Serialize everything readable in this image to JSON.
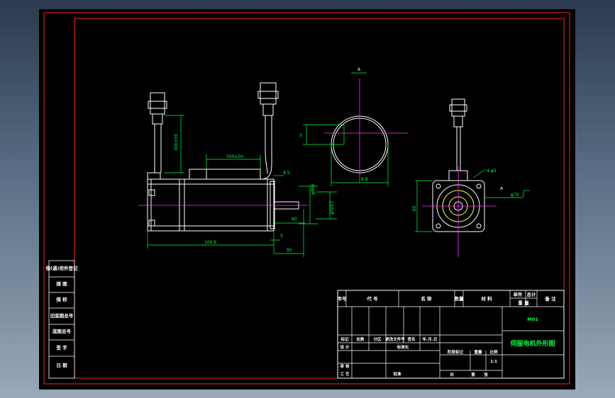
{
  "drawing": {
    "title": "伺服电机外形图",
    "part_code": "M01",
    "scale": "1:1",
    "sheet_total": "共",
    "sheet_page": "第",
    "sheet_unit": "张"
  },
  "dimensions": {
    "cable1_length": "300±50",
    "cable2_length": "300±50",
    "flange_thickness": "8.5",
    "shaft_dia": "φ8h6",
    "pilot_dia": "φ50h7",
    "shaft_length": "60",
    "body_length": "100.6",
    "lip": "5",
    "overall": "95",
    "key_depth": "3",
    "keyway_width": "8.8",
    "flange_square": "60",
    "hole_callout": "4-φ5",
    "hole_pcd": "φ70",
    "section_mark": "A"
  },
  "side_table": [
    {
      "label": "借(通)用件登记"
    },
    {
      "label": "描 图"
    },
    {
      "label": "描 校"
    },
    {
      "label": "旧底图总号"
    },
    {
      "label": "底图总号"
    },
    {
      "label": "签 字"
    },
    {
      "label": "日 期"
    }
  ],
  "title_block": {
    "header": [
      "序号",
      "代 号",
      "名 称",
      "数量",
      "材 料",
      "单件",
      "总计",
      "备 注"
    ],
    "weight": "重 量",
    "rev_row": [
      "标记",
      "处数",
      "分区",
      "更改文件号",
      "签名",
      "年.月.日"
    ],
    "design": "设 计",
    "standardize": "标准化",
    "stage_mark": "阶段标记",
    "weight_label": "重量",
    "scale_label": "比例",
    "check": "审 核",
    "process": "工 艺",
    "approve": "批准"
  },
  "colors": {
    "background": "#000000",
    "border": "#ff2020",
    "outline": "#ffffff",
    "dimension": "#00ff40",
    "centerline": "#ff30ff",
    "hidden": "#00ffff"
  }
}
